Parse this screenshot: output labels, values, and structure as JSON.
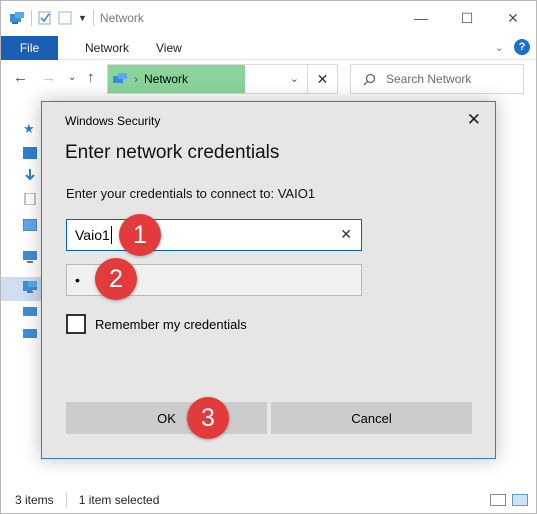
{
  "window": {
    "title": "Network",
    "ribbon_tabs": [
      "File",
      "Network",
      "View"
    ],
    "address_path": "Network",
    "search_placeholder": "Search Network",
    "status_items": "3 items",
    "status_selected": "1 item selected"
  },
  "dialog": {
    "caption": "Windows Security",
    "heading": "Enter network credentials",
    "prompt": "Enter your credentials to connect to: VAIO1",
    "username_value": "Vaio1",
    "password_mask": "•",
    "remember_label": "Remember my credentials",
    "ok_label": "OK",
    "cancel_label": "Cancel"
  },
  "markers": [
    "1",
    "2",
    "3"
  ],
  "colors": {
    "marker": "#e33b3b",
    "file_tab": "#1a5fb4",
    "address_highlight": "#8ad39a",
    "dialog_border": "#3c7cc7"
  }
}
